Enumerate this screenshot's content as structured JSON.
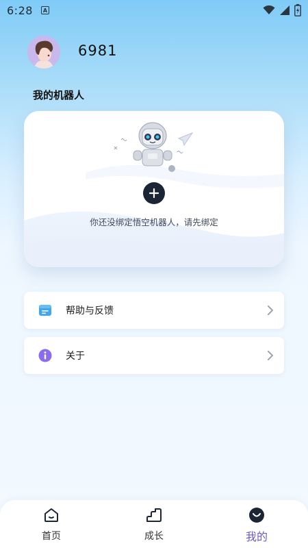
{
  "status_bar": {
    "time": "6:28",
    "notif_letter": "A"
  },
  "profile": {
    "username": "6981"
  },
  "section": {
    "title": "我的机器人"
  },
  "robot_card": {
    "hint": "你还没绑定悟空机器人，请先绑定",
    "add_symbol": "+"
  },
  "menu": [
    {
      "label": "帮助与反馈",
      "icon": "feedback-icon"
    },
    {
      "label": "关于",
      "icon": "info-icon"
    }
  ],
  "bottom_nav": [
    {
      "label": "首页",
      "icon": "home-icon",
      "active": false
    },
    {
      "label": "成长",
      "icon": "growth-icon",
      "active": false
    },
    {
      "label": "我的",
      "icon": "profile-icon",
      "active": true
    }
  ],
  "colors": {
    "accent": "#6b5ac5",
    "add_button": "#1c2536",
    "feedback_icon": "#3ea6f3",
    "info_icon": "#8a6cf0"
  }
}
